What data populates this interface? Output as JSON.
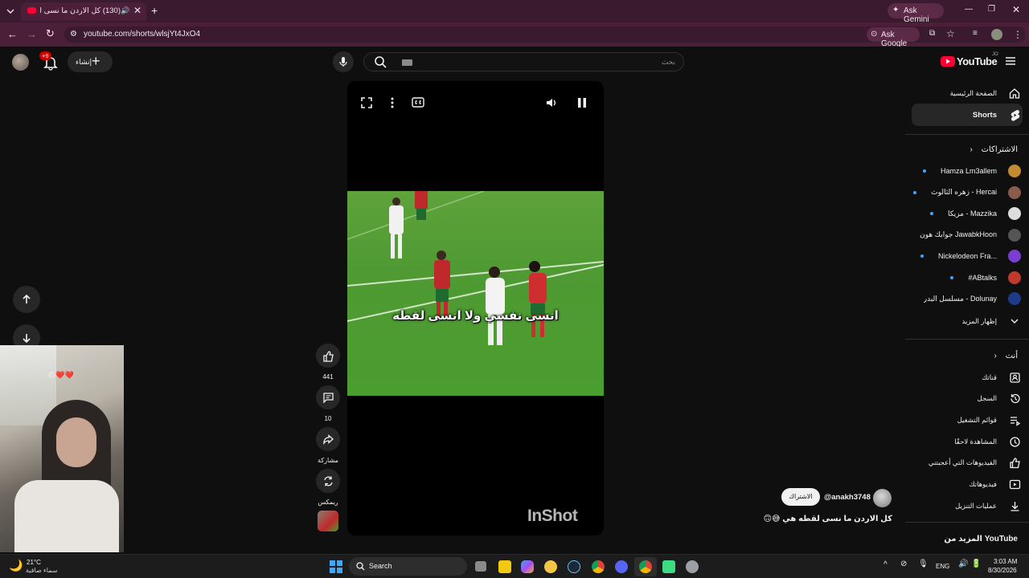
{
  "browser": {
    "tab_title": "(130) كل الاردن ما نسى لقطه",
    "url": "youtube.com/shorts/wlsjYt4JxO4",
    "ask_gemini": "Ask Gemini",
    "ask_google": "Ask Google"
  },
  "header": {
    "logo_text": "YouTube",
    "country_code": "JO",
    "search_placeholder": "بحث",
    "create_label": "إنشاء",
    "notif_count": "+9"
  },
  "player": {
    "subtitle": "انسى نفسي ولا انسى لقطه",
    "watermark": "InShot"
  },
  "actions": {
    "likes": "441",
    "comments": "10",
    "share": "مشاركة",
    "remix": "ريمكس"
  },
  "channel": {
    "handle": "@anakh3748",
    "subscribe": "الاشتراك",
    "caption": "كل الاردن ما نسى لقطه هي 😅🙃"
  },
  "sidebar": {
    "home": "الصفحة الرئيسية",
    "shorts": "Shorts",
    "subscriptions_title": "الاشتراكات",
    "subscriptions": [
      {
        "name": "Hamza Lm3allem",
        "dot": true,
        "color": "#c48a2f"
      },
      {
        "name": "زهره الثالوث - Hercai",
        "dot": true,
        "color": "#8a5a4a"
      },
      {
        "name": "مزيكا - Mazzika",
        "dot": true,
        "color": "#dddddd"
      },
      {
        "name": "جوابك هون JawabkHoon",
        "dot": false,
        "color": "#555555"
      },
      {
        "name": "Nickelodeon Fra...",
        "dot": true,
        "color": "#7a3fd1"
      },
      {
        "name": "#ABtalks",
        "dot": true,
        "color": "#c0392b"
      },
      {
        "name": "مسلسل البدر - Dolunay",
        "dot": false,
        "color": "#1e3a8a"
      }
    ],
    "show_more": "إظهار المزيد",
    "you_title": "أنت",
    "you_items": [
      "قناتك",
      "السجل",
      "قوائم التشغيل",
      "المشاهدة لاحقًا",
      "الفيديوهات التي أعجبتني",
      "فيديوهاتك",
      "عمليات التنزيل"
    ],
    "more_from": "المزيد من YouTube"
  },
  "taskbar": {
    "weather_temp": "21°C",
    "weather_desc": "سماء صافية",
    "search": "Search",
    "lang": "ENG",
    "time": "3:03 AM",
    "date": "8/30/2026"
  },
  "colors": {
    "accent": "#ff0033",
    "field": "#4a9d2f"
  }
}
